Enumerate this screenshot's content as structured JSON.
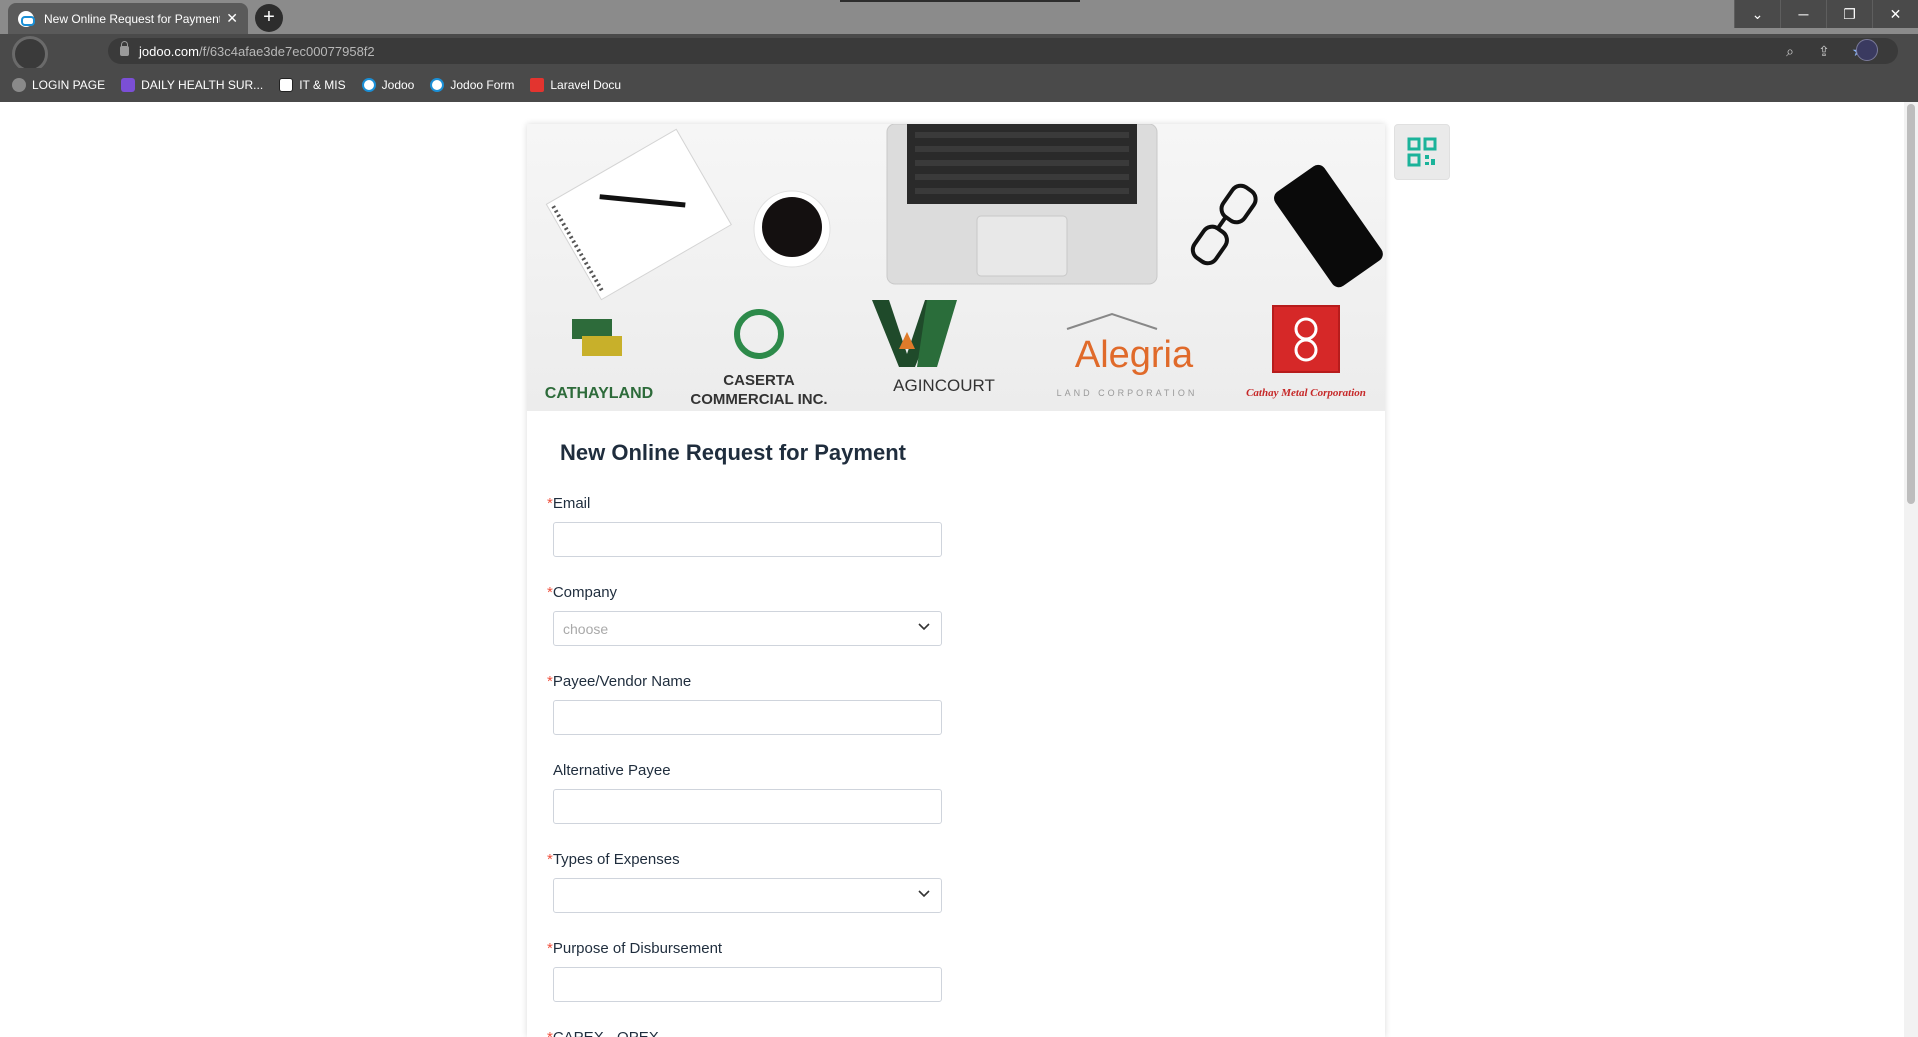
{
  "browser": {
    "tab_title": "New Online Request for Payment",
    "url_host": "jodoo.com",
    "url_path": "/f/63c4afae3de7ec00077958f2",
    "bookmarks": [
      {
        "label": "LOGIN PAGE",
        "icon": "globe-icon"
      },
      {
        "label": "DAILY HEALTH SUR...",
        "icon": "list-icon"
      },
      {
        "label": "IT & MIS",
        "icon": "notion-icon"
      },
      {
        "label": "Jodoo",
        "icon": "jodoo-icon"
      },
      {
        "label": "Jodoo Form",
        "icon": "jodoo-icon"
      },
      {
        "label": "Laravel Docu",
        "icon": "laravel-icon"
      }
    ]
  },
  "banner": {
    "logos": [
      "CATHAYLAND",
      "CASERTA",
      "COMMERCIAL INC.",
      "AGINCOURT",
      "Alegria",
      "LAND CORPORATION",
      "Cathay Metal Corporation"
    ]
  },
  "form": {
    "title": "New Online Request for Payment",
    "fields": [
      {
        "label": "Email",
        "required": true,
        "type": "text",
        "value": ""
      },
      {
        "label": "Company",
        "required": true,
        "type": "select",
        "placeholder": "choose"
      },
      {
        "label": "Payee/Vendor Name",
        "required": true,
        "type": "text",
        "value": ""
      },
      {
        "label": "Alternative Payee",
        "required": false,
        "type": "text",
        "value": ""
      },
      {
        "label": "Types of Expenses",
        "required": true,
        "type": "select",
        "placeholder": ""
      },
      {
        "label": "Purpose of Disbursement",
        "required": true,
        "type": "text",
        "value": ""
      },
      {
        "label": "CAPEX - OPEX",
        "required": true,
        "type": "text",
        "value": ""
      }
    ],
    "required_marker": "*"
  },
  "colors": {
    "required": "#f0503c",
    "qr": "#1bb39a"
  }
}
